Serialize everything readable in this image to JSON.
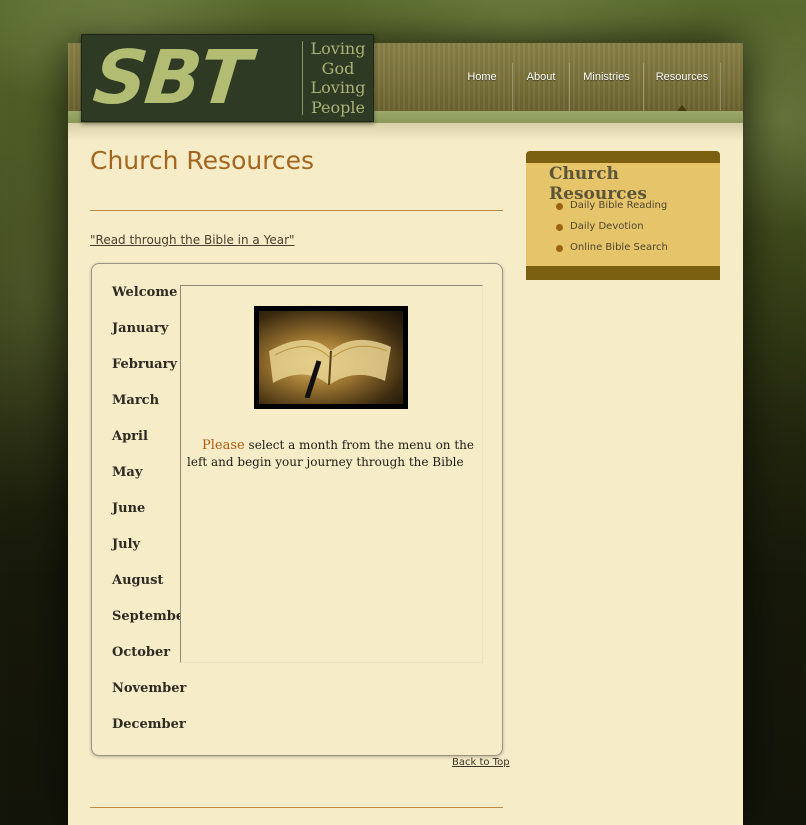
{
  "logo": {
    "mark": "SBT",
    "tagline": [
      "Loving",
      "God",
      "Loving",
      "People"
    ]
  },
  "nav": [
    "Home",
    "About",
    "Ministries",
    "Resources"
  ],
  "nav_active": "Resources",
  "page_title": "Church Resources",
  "bible_year_link": "\"Read through the Bible in a Year\"",
  "months": [
    "Welcome",
    "January",
    "February",
    "March",
    "April",
    "May",
    "June",
    "July",
    "August",
    "September",
    "October",
    "November",
    "December"
  ],
  "intro": {
    "highlight": "Please",
    "text": " select a month from the menu on the left and begin your journey through the Bible"
  },
  "back_to_top": "Back to Top",
  "sidebar": {
    "title": "Church Resources",
    "items": [
      "Daily Bible Reading",
      "Daily Devotion",
      "Online Bible Search"
    ]
  },
  "colors": {
    "accent": "#a3661e",
    "sidebar_bg": "#e6c56a",
    "page_bg": "#f6ecc8",
    "logo_bg": "#2f3a25"
  }
}
